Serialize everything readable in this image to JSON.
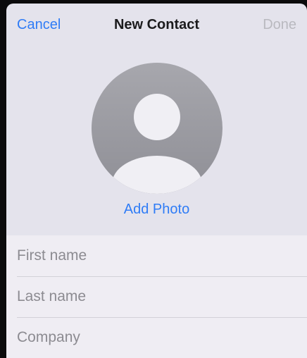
{
  "nav": {
    "cancel_label": "Cancel",
    "title": "New Contact",
    "done_label": "Done"
  },
  "avatar": {
    "icon": "person-silhouette-icon"
  },
  "add_photo_label": "Add Photo",
  "fields": [
    {
      "placeholder": "First name",
      "value": ""
    },
    {
      "placeholder": "Last name",
      "value": ""
    },
    {
      "placeholder": "Company",
      "value": ""
    }
  ],
  "colors": {
    "accent": "#2f7cf6",
    "disabled": "#b9b9bf",
    "background": "#e4e3ec",
    "field_background": "#efedf3",
    "avatar_gray": "#9b9ba2"
  }
}
